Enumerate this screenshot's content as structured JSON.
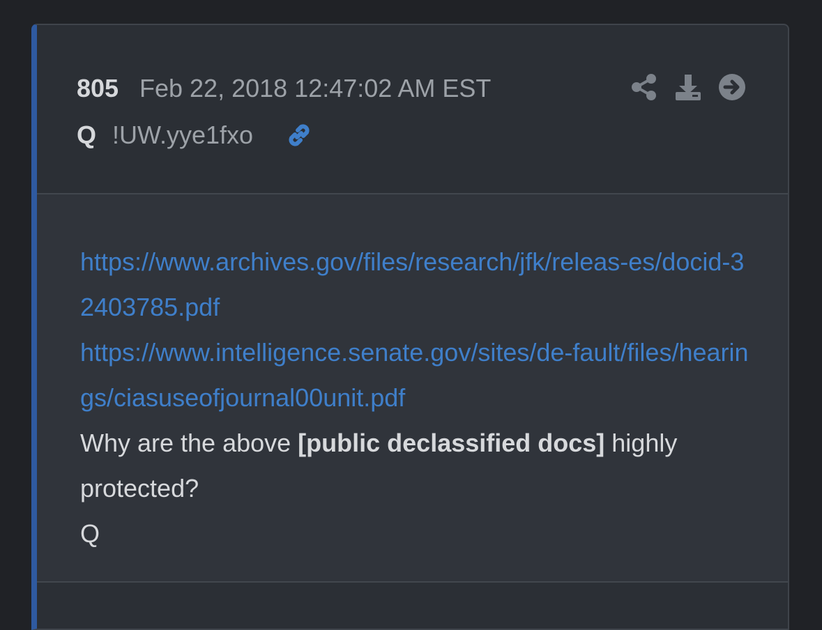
{
  "post": {
    "number": "805",
    "date": "Feb 22, 2018 12:47:02 AM EST",
    "author": "Q",
    "tripcode": "!UW.yye1fxo",
    "icons": {
      "link": "link-icon",
      "share": "share-icon",
      "download": "download-icon",
      "open": "arrow-circle-right-icon"
    },
    "colors": {
      "accent_bar": "#2f5aa0",
      "link": "#3f7fca"
    },
    "links": [
      "https://www.archives.gov/files/research/jfk/releas-es/docid-32403785.pdf",
      "https://www.intelligence.senate.gov/sites/de-fault/files/hearings/ciasuseofjournal00unit.pdf"
    ],
    "message": {
      "before_bold": "Why are the above ",
      "bold": "[public declassified docs]",
      "after_bold": " highly protected?",
      "signature": "Q"
    }
  }
}
